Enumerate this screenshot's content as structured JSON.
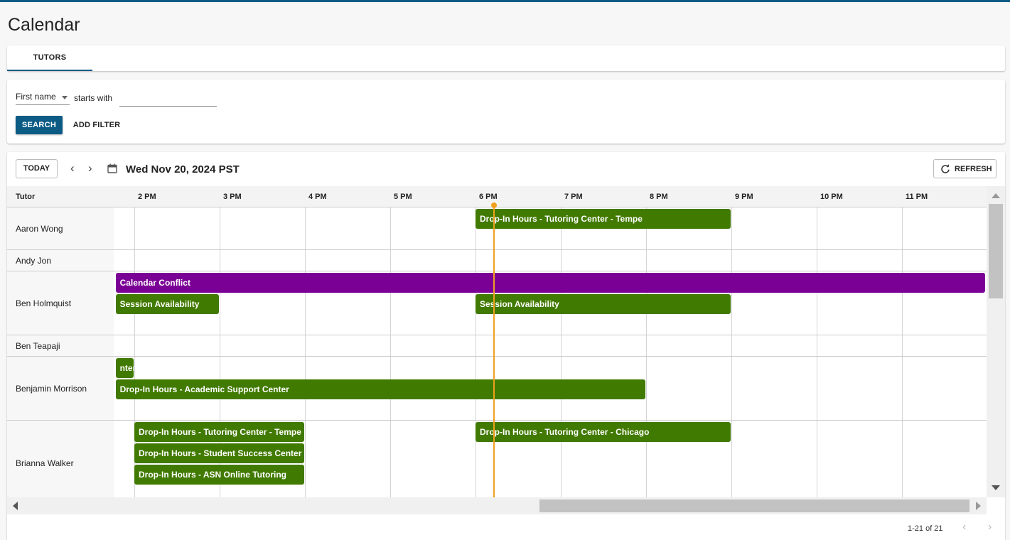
{
  "page": {
    "title": "Calendar"
  },
  "tabs": [
    {
      "label": "TUTORS",
      "active": true
    }
  ],
  "filter": {
    "field": "First name",
    "operator": "starts with",
    "value": "",
    "search_label": "SEARCH",
    "add_filter_label": "ADD FILTER"
  },
  "toolbar": {
    "today_label": "TODAY",
    "date": "Wed Nov 20, 2024 PST",
    "refresh_label": "REFRESH"
  },
  "grid": {
    "tutor_header": "Tutor",
    "hours": [
      "2 PM",
      "3 PM",
      "4 PM",
      "5 PM",
      "6 PM",
      "7 PM",
      "8 PM",
      "9 PM",
      "10 PM",
      "11 PM"
    ],
    "tutors": [
      {
        "name": "Aaron Wong",
        "events": [
          {
            "label": "Drop-In Hours - Tutoring Center - Tempe",
            "start": 18.0,
            "end": 21.0,
            "lane": 0,
            "kind": "drop-in"
          }
        ]
      },
      {
        "name": "Andy Jon",
        "events": []
      },
      {
        "name": "Ben Holmquist",
        "events": [
          {
            "label": "Calendar Conflict",
            "start": 13.78,
            "end": 24.0,
            "lane": 0,
            "kind": "conflict"
          },
          {
            "label": "Session Availability",
            "start": 13.78,
            "end": 15.0,
            "lane": 1,
            "kind": "availability"
          },
          {
            "label": "Session Availability",
            "start": 18.0,
            "end": 21.0,
            "lane": 1,
            "kind": "availability"
          }
        ]
      },
      {
        "name": "Ben Teapaji",
        "events": []
      },
      {
        "name": "Benjamin Morrison",
        "events": [
          {
            "label": "nter",
            "start": 13.78,
            "end": 14.0,
            "lane": 0,
            "kind": "drop-in"
          },
          {
            "label": "Drop-In Hours - Academic Support Center",
            "start": 13.78,
            "end": 20.0,
            "lane": 1,
            "kind": "drop-in"
          }
        ]
      },
      {
        "name": "Brianna Walker",
        "events": [
          {
            "label": "Drop-In Hours - Tutoring Center - Tempe",
            "start": 14.0,
            "end": 16.0,
            "lane": 0,
            "kind": "drop-in"
          },
          {
            "label": "Drop-In Hours - Tutoring Center - Chicago",
            "start": 18.0,
            "end": 21.0,
            "lane": 0,
            "kind": "drop-in"
          },
          {
            "label": "Drop-In Hours - Student Success Center",
            "start": 14.0,
            "end": 16.0,
            "lane": 1,
            "kind": "drop-in"
          },
          {
            "label": "Drop-In Hours - ASN Online Tutoring",
            "start": 14.0,
            "end": 16.0,
            "lane": 2,
            "kind": "drop-in"
          }
        ]
      }
    ],
    "current_time_hour": 18.22
  },
  "pagination": {
    "range": "1-21 of 21"
  },
  "colors": {
    "primary": "#0b5b85",
    "drop_in": "#417a00",
    "conflict": "#7a0095",
    "now_line": "#f0a020"
  },
  "icons": {
    "prev": "chevron-left-icon",
    "next": "chevron-right-icon",
    "calendar": "calendar-icon",
    "refresh": "refresh-icon"
  }
}
